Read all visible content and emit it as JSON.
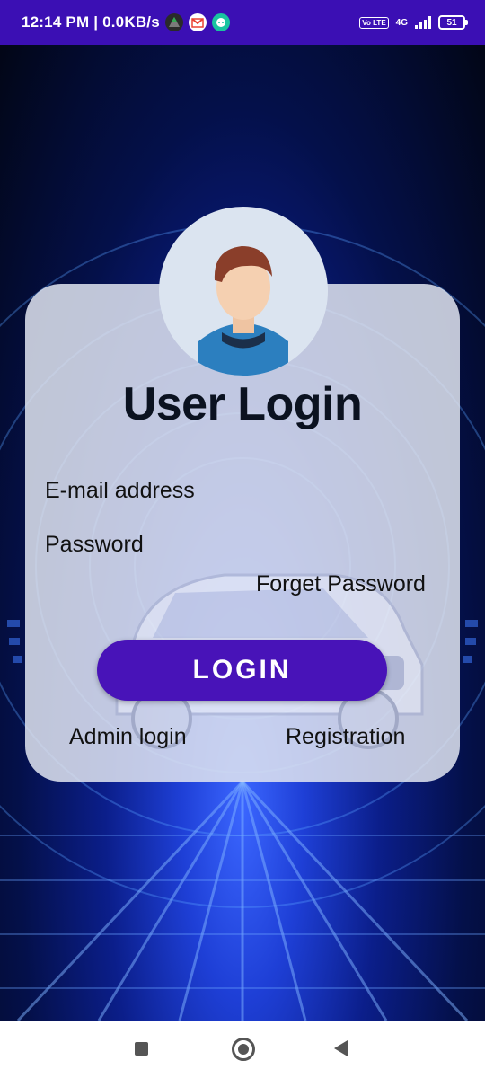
{
  "status_bar": {
    "time_and_speed": "12:14 PM | 0.0KB/s",
    "network_type": "4G",
    "volte_label": "Vo LTE",
    "battery_level": "51"
  },
  "login": {
    "title": "User Login",
    "email_label": "E-mail address",
    "password_label": "Password",
    "forget_password": "Forget Password",
    "login_button": "LOGIN",
    "admin_login": "Admin login",
    "registration": "Registration"
  },
  "colors": {
    "status_bar": "#3b0fb4",
    "button": "#4813b8",
    "card": "#e0e4f0"
  }
}
